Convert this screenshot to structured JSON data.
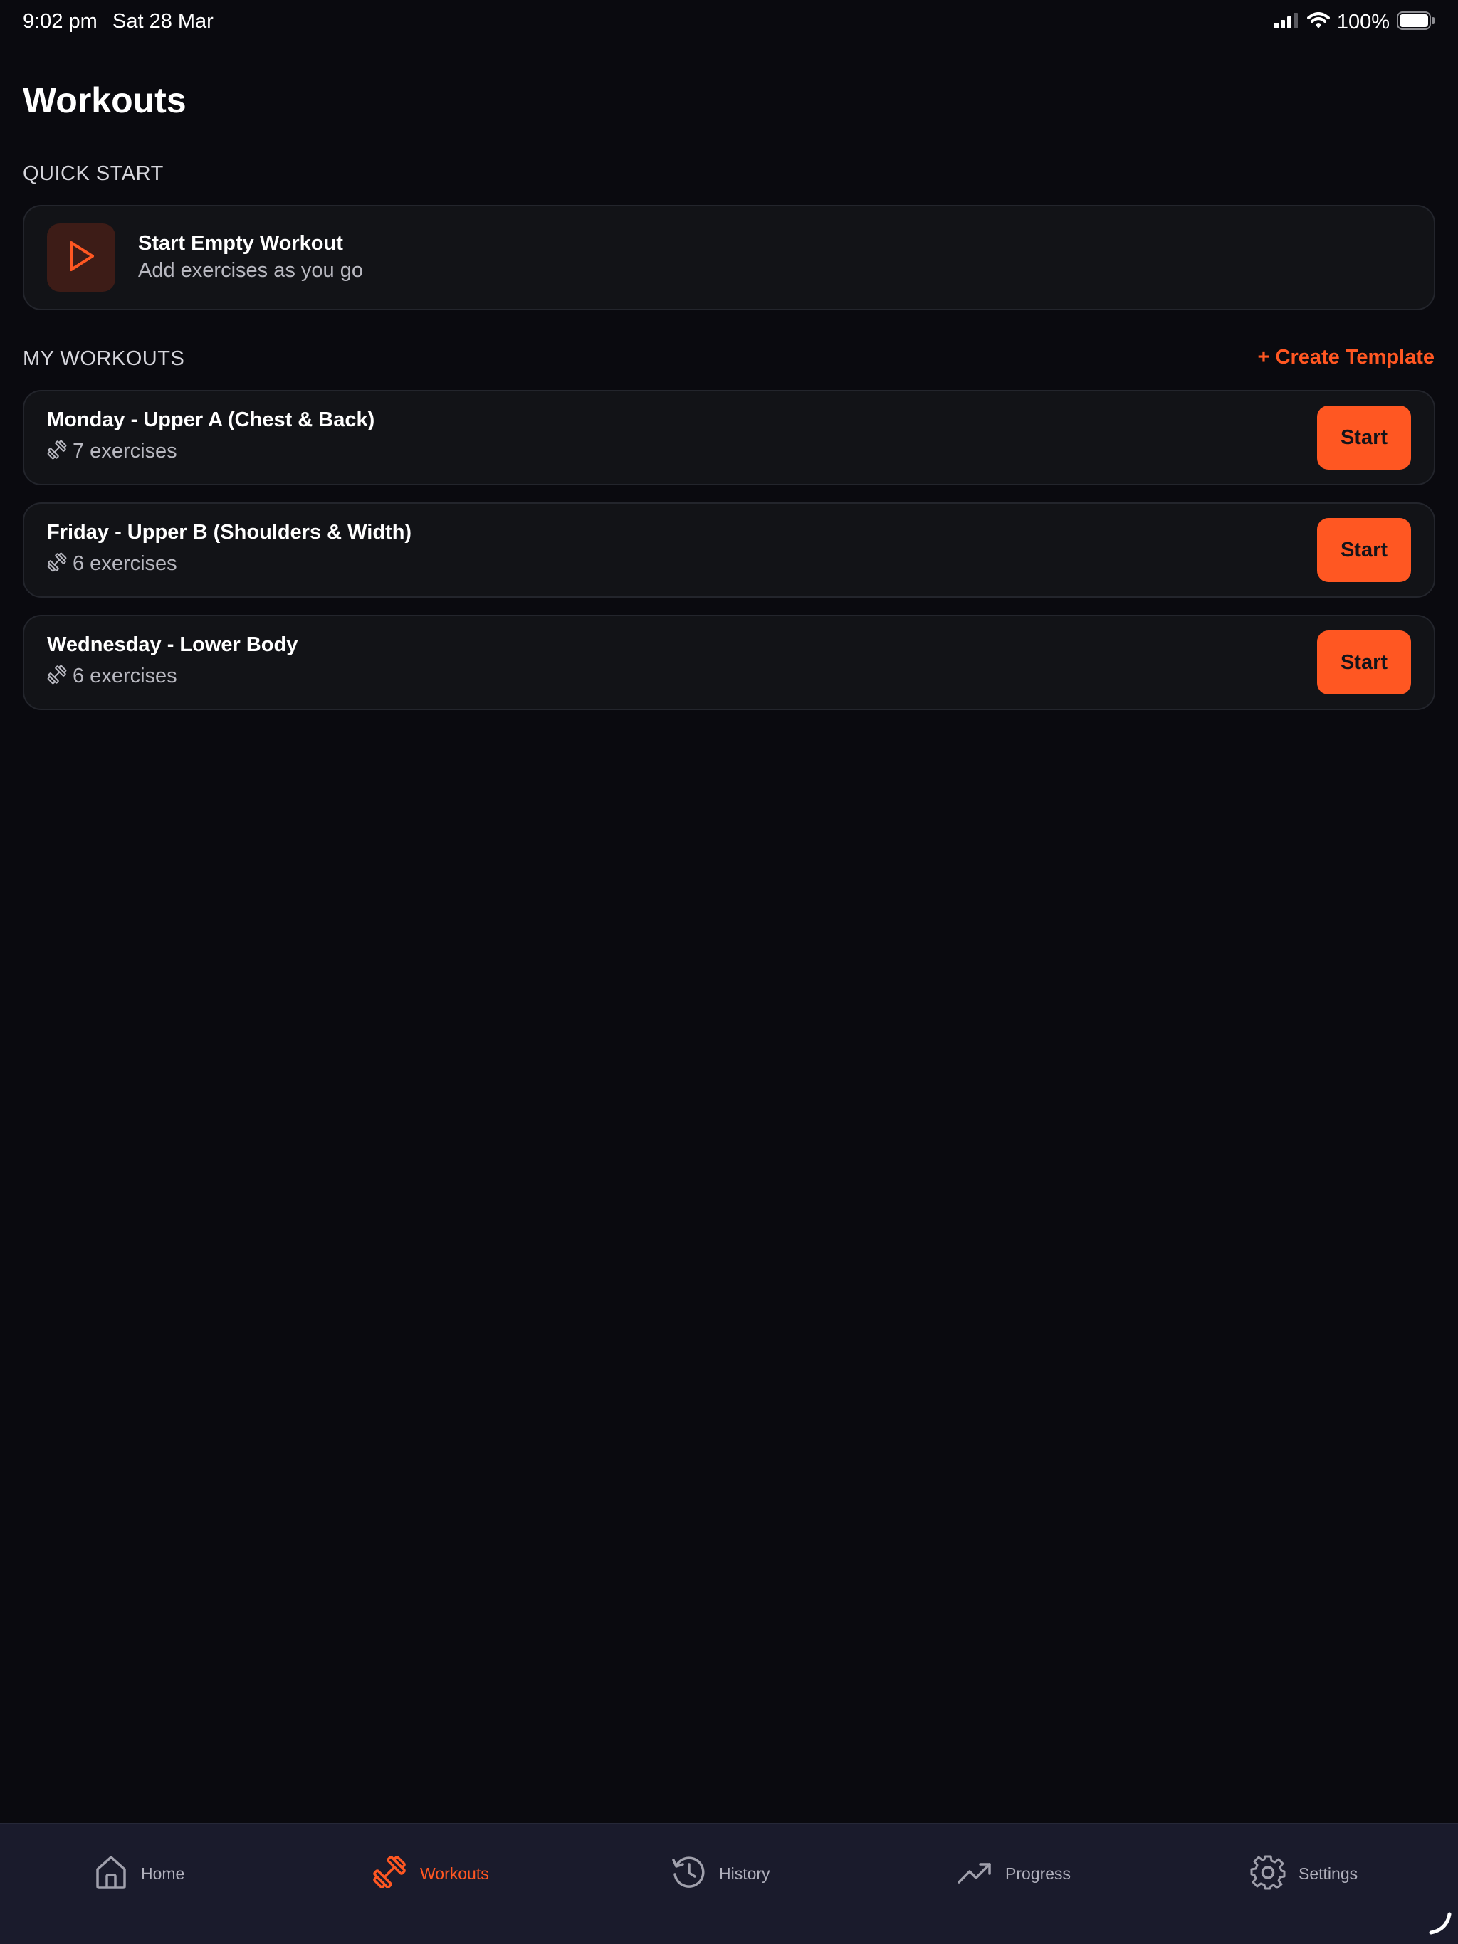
{
  "status_bar": {
    "time": "9:02 pm",
    "date": "Sat 28 Mar",
    "battery": "100%"
  },
  "page": {
    "title": "Workouts"
  },
  "quick_start": {
    "section_label": "QUICK START",
    "title": "Start Empty Workout",
    "subtitle": "Add exercises as you go",
    "icon": "play-icon"
  },
  "my_workouts": {
    "section_label": "MY WORKOUTS",
    "create_label": "+ Create Template",
    "items": [
      {
        "title": "Monday - Upper A (Chest & Back)",
        "count": "7 exercises",
        "button": "Start"
      },
      {
        "title": "Friday - Upper B (Shoulders & Width)",
        "count": "6 exercises",
        "button": "Start"
      },
      {
        "title": "Wednesday - Lower Body",
        "count": "6 exercises",
        "button": "Start"
      }
    ]
  },
  "tabs": [
    {
      "label": "Home",
      "icon": "home-icon",
      "active": false
    },
    {
      "label": "Workouts",
      "icon": "dumbbell-icon",
      "active": true
    },
    {
      "label": "History",
      "icon": "history-icon",
      "active": false
    },
    {
      "label": "Progress",
      "icon": "trending-up-icon",
      "active": false
    },
    {
      "label": "Settings",
      "icon": "gear-icon",
      "active": false
    }
  ],
  "colors": {
    "background": "#0a0a0f",
    "accent": "#ff5722",
    "card": "#121317",
    "tab_bar": "#1a1b2c"
  }
}
